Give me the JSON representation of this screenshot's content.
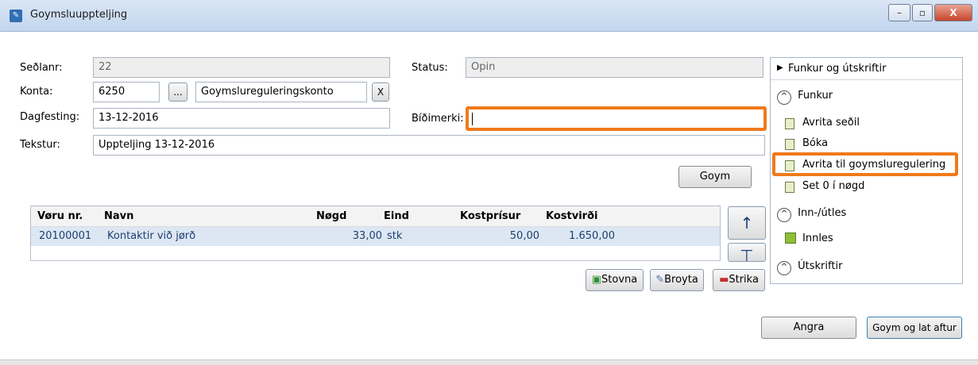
{
  "window": {
    "title": "Goymsluuppteljing",
    "min": "–",
    "max": "▫",
    "close": "X"
  },
  "form": {
    "seolanr_label": "Seðlanr:",
    "seolanr_value": "22",
    "status_label": "Status:",
    "status_value": "Opin",
    "konta_label": "Konta:",
    "konta_value": "6250",
    "konta_browse": "...",
    "konta_name": "Goymslureguleringskonto",
    "konta_clear": "X",
    "dagfesting_label": "Dagfesting:",
    "dagfesting_value": "13-12-2016",
    "bidimerki_label": "Bíðimerki:",
    "bidimerki_value": "",
    "tekstur_label": "Tekstur:",
    "tekstur_value": "Uppteljing 13-12-2016",
    "goym_label": "Goym"
  },
  "table": {
    "headers": [
      "Vøru nr.",
      "Navn",
      "Nøgd",
      "Eind",
      "Kostprísur",
      "Kostvirði"
    ],
    "rows": [
      [
        "20100001",
        "Kontaktir við jørð",
        "33,00",
        "stk",
        "50,00",
        "1.650,00"
      ]
    ],
    "up_icon": "up-arrow-icon",
    "down_icon": "down-bar-icon"
  },
  "row_actions": {
    "stovna": "Stovna",
    "broyta": "Broyta",
    "strika": "Strika"
  },
  "side_panel": {
    "header": "Funkur og útskriftir",
    "sections": [
      {
        "title": "Funkur",
        "items": [
          "Avrita seðil",
          "Bóka",
          "Avrita til goymsluregulering",
          "Set 0 í nøgd"
        ]
      },
      {
        "title": "Inn-/útles",
        "items": [
          "Innles"
        ]
      },
      {
        "title": "Útskriftir",
        "items": []
      }
    ]
  },
  "footer": {
    "angra": "Angra",
    "goym_lat": "Goym og lat aftur"
  },
  "colors": {
    "highlight": "#f07a1a",
    "row_selected": "#dde7f3"
  }
}
